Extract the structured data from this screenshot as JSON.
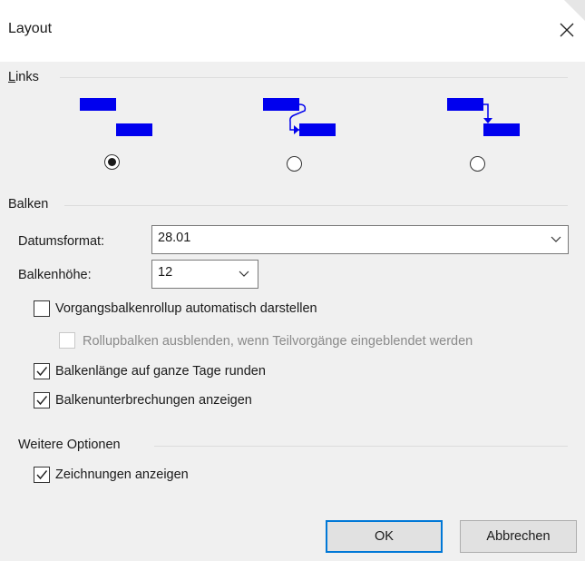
{
  "dialog": {
    "title": "Layout"
  },
  "icons": {
    "close": "close-icon",
    "chevron": "chevron-down-icon",
    "check": "check-icon"
  },
  "colors": {
    "link_bar": "#0000ee",
    "primary_border": "#0078d7"
  },
  "links": {
    "section_label_first": "L",
    "section_label_rest": "inks",
    "options": [
      {
        "style": "no-lines",
        "selected": true
      },
      {
        "style": "curved-lines",
        "selected": false
      },
      {
        "style": "straight-lines",
        "selected": false
      }
    ]
  },
  "balken": {
    "section_label": "Balken",
    "datumsformat": {
      "label": "Datumsformat:",
      "value": "28.01"
    },
    "balkenhoehe": {
      "label": "Balkenhöhe:",
      "value": "12"
    },
    "checkboxes": [
      {
        "label": "Vorgangsbalkenrollup automatisch darstellen",
        "checked": false,
        "disabled": false
      },
      {
        "label": "Rollupbalken ausblenden, wenn Teilvorgänge eingeblendet werden",
        "checked": false,
        "disabled": true
      },
      {
        "label": "Balkenlänge auf ganze Tage runden",
        "checked": true,
        "disabled": false
      },
      {
        "label": "Balkenunterbrechungen anzeigen",
        "checked": true,
        "disabled": false
      }
    ]
  },
  "weitere": {
    "section_label": "Weitere Optionen",
    "checkboxes": [
      {
        "label": "Zeichnungen anzeigen",
        "checked": true,
        "disabled": false
      }
    ]
  },
  "buttons": {
    "ok": "OK",
    "cancel": "Abbrechen"
  }
}
